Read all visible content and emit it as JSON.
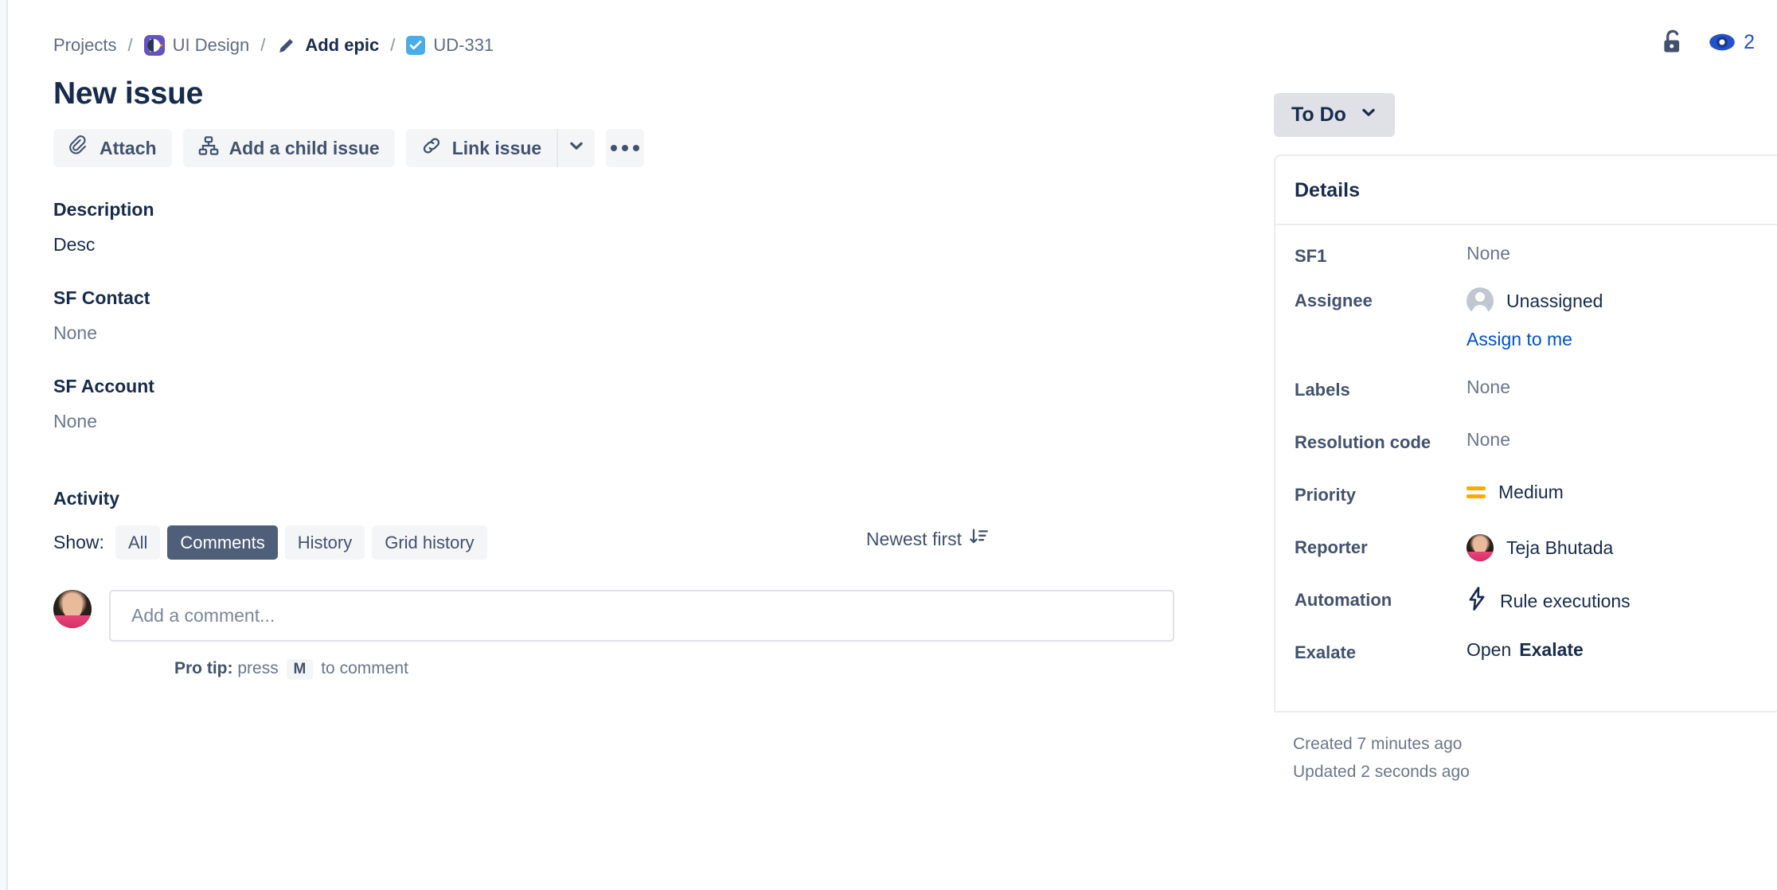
{
  "breadcrumb": {
    "projects_label": "Projects",
    "project_name": "UI Design",
    "epic_label": "Add epic",
    "issue_key": "UD-331",
    "separator": "/"
  },
  "header": {
    "title": "New issue",
    "watch_count": "2",
    "lock_icon": "unlocked-padlock-icon",
    "watch_icon": "eye-icon"
  },
  "actions": {
    "attach": "Attach",
    "add_child": "Add a child issue",
    "link_issue": "Link issue",
    "chevron_icon": "chevron-down-icon",
    "more_icon": "more-actions-icon"
  },
  "fields": [
    {
      "label": "Description",
      "value": "Desc",
      "muted": false
    },
    {
      "label": "SF Contact",
      "value": "None",
      "muted": true
    },
    {
      "label": "SF Account",
      "value": "None",
      "muted": true
    }
  ],
  "activity": {
    "heading": "Activity",
    "show_label": "Show:",
    "tabs": [
      {
        "label": "All",
        "active": false
      },
      {
        "label": "Comments",
        "active": true
      },
      {
        "label": "History",
        "active": false
      },
      {
        "label": "Grid history",
        "active": false
      }
    ],
    "sort_label": "Newest first",
    "sort_icon": "sort-descending-icon",
    "comment_placeholder": "Add a comment...",
    "protip_prefix": "Pro tip:",
    "protip_press": "press",
    "protip_key": "M",
    "protip_suffix": "to comment"
  },
  "right_panel": {
    "status": "To Do",
    "status_chevron": "chevron-down-icon",
    "details_title": "Details",
    "rows": [
      {
        "label": "SF1",
        "value": "None",
        "muted": true,
        "icon": ""
      },
      {
        "label": "Assignee",
        "value": "Unassigned",
        "muted": false,
        "icon": "user-avatar-icon"
      },
      {
        "label": "Labels",
        "value": "None",
        "muted": true,
        "icon": ""
      },
      {
        "label": "Resolution code",
        "value": "None",
        "muted": true,
        "icon": ""
      },
      {
        "label": "Priority",
        "value": "Medium",
        "muted": false,
        "icon": "priority-medium-icon"
      },
      {
        "label": "Reporter",
        "value": "Teja Bhutada",
        "muted": false,
        "icon": "reporter-avatar"
      },
      {
        "label": "Automation",
        "value": "Rule executions",
        "muted": false,
        "icon": "lightning-bolt-icon"
      }
    ],
    "assign_to_me": "Assign to me",
    "exalate_label": "Exalate",
    "exalate_open": "Open",
    "exalate_name": "Exalate",
    "created": "Created 7 minutes ago",
    "updated": "Updated 2 seconds ago"
  },
  "colors": {
    "accent_link": "#0052CC",
    "status_bg": "#DFE1E6",
    "priority_medium": "#FFAB00",
    "task_icon": "#4BADE8",
    "project_icon": "#6554C0"
  }
}
